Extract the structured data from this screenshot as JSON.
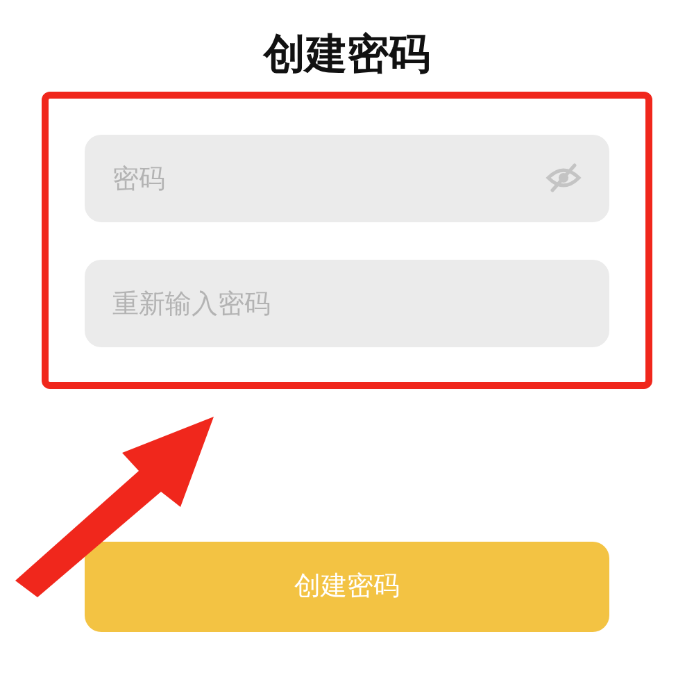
{
  "title": "创建密码",
  "fields": [
    {
      "placeholder": "密码",
      "kind": "password"
    },
    {
      "placeholder": "重新输入密码",
      "kind": "text"
    }
  ],
  "submit_button": {
    "label": "创建密码"
  }
}
